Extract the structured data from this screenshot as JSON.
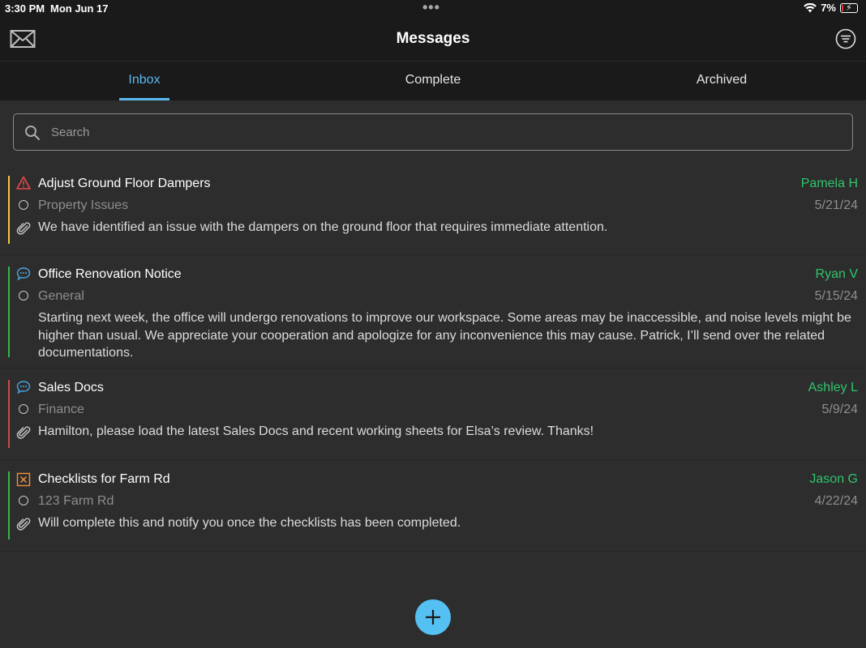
{
  "status": {
    "time": "3:30 PM",
    "date": "Mon Jun 17",
    "battery": "7%"
  },
  "header": {
    "title": "Messages"
  },
  "tabs": [
    {
      "label": "Inbox",
      "active": true
    },
    {
      "label": "Complete",
      "active": false
    },
    {
      "label": "Archived",
      "active": false
    }
  ],
  "search": {
    "placeholder": "Search",
    "value": ""
  },
  "messages": [
    {
      "title": "Adjust Ground Floor Dampers",
      "sender": "Pamela H",
      "category": "Property Issues",
      "date": "5/21/24",
      "preview": "We have identified an issue with the dampers on the ground floor that requires immediate attention.",
      "type_icon": "warning-icon",
      "has_attachment": true,
      "bar_color": "#f5c542"
    },
    {
      "title": "Office Renovation Notice",
      "sender": "Ryan V",
      "category": "General",
      "date": "5/15/24",
      "preview": "Starting next week, the office will undergo renovations to improve our workspace. Some areas may be inaccessible, and noise levels might be higher than usual. We appreciate your cooperation and apologize for any inconvenience this may cause. Patrick, I’ll send over the related documentations.",
      "type_icon": "chat-bubble-icon",
      "has_attachment": false,
      "bar_color": "#33b54a"
    },
    {
      "title": "Sales Docs",
      "sender": "Ashley L",
      "category": "Finance",
      "date": "5/9/24",
      "preview": "Hamilton, please load the latest Sales Docs and recent working sheets for Elsa’s review. Thanks!",
      "type_icon": "chat-bubble-icon",
      "has_attachment": true,
      "bar_color": "#c94a4a"
    },
    {
      "title": "Checklists for Farm Rd",
      "sender": "Jason G",
      "category": "123 Farm Rd",
      "date": "4/22/24",
      "preview": "Will complete this and notify you once the checklists has been completed.",
      "type_icon": "checklist-icon",
      "has_attachment": true,
      "bar_color": "#33b54a"
    }
  ],
  "colors": {
    "accent": "#5bb8ee",
    "sender": "#2fc56b",
    "fab": "#55c0f2",
    "warning": "#e84a4a",
    "checklist": "#f0913a"
  }
}
